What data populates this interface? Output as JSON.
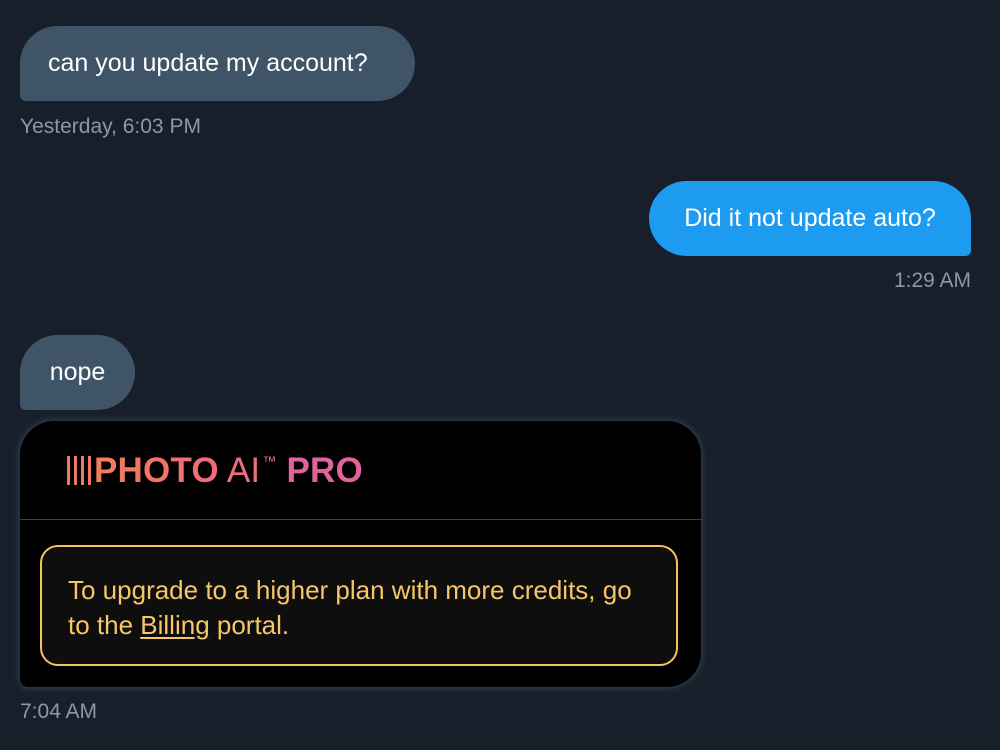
{
  "messages": [
    {
      "direction": "incoming",
      "text": "can you update my account?",
      "time": "Yesterday, 6:03 PM"
    },
    {
      "direction": "outgoing",
      "text": "Did it not update auto?",
      "time": "1:29 AM"
    },
    {
      "direction": "incoming",
      "text": "nope"
    }
  ],
  "card": {
    "brand": {
      "bars": "||||",
      "photo": "PHOTO",
      "ai": "AI",
      "tm": "™",
      "pro": "PRO"
    },
    "notice_before": "To upgrade to a higher plan with more credits, go to the ",
    "notice_link": "Billing",
    "notice_after": " portal.",
    "time": "7:04 AM"
  },
  "colors": {
    "background": "#17202a",
    "incoming_bubble": "#3f5466",
    "outgoing_bubble": "#1d9bf0",
    "card_accent": "#f4c35a",
    "brand_orange": "#f47c5c",
    "brand_pink": "#e0639c"
  }
}
